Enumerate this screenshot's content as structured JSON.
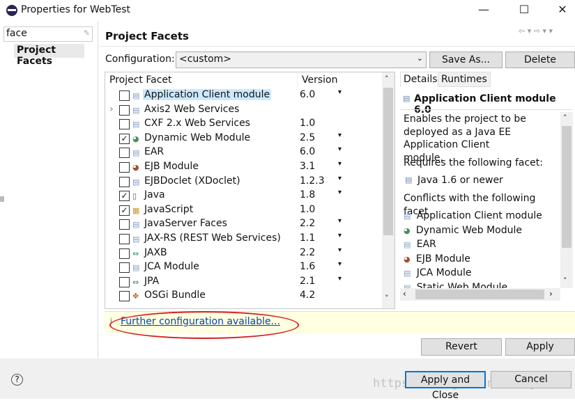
{
  "window": {
    "title": "Properties for WebTest",
    "minimize": "—",
    "maximize": "☐",
    "close": "✕"
  },
  "sidebar": {
    "filter_value": "face",
    "items": [
      {
        "label": "Project Facets",
        "selected": true
      }
    ]
  },
  "page": {
    "title": "Project Facets",
    "nav": "⇦ ▾ ⇨ ▾ ▾"
  },
  "configuration": {
    "label": "Configuration:",
    "value": "<custom>",
    "save_as": "Save As...",
    "delete": "Delete"
  },
  "facets": {
    "columns": [
      "Project Facet",
      "Version"
    ],
    "rows": [
      {
        "name": "Application Client module",
        "version": "6.0",
        "checked": false,
        "dropdown": true,
        "icon": "file-icon",
        "selected": true
      },
      {
        "name": "Axis2 Web Services",
        "version": "",
        "checked": false,
        "dropdown": false,
        "icon": "file-icon",
        "expandable": true
      },
      {
        "name": "CXF 2.x Web Services",
        "version": "1.0",
        "checked": false,
        "dropdown": false,
        "icon": "file-icon"
      },
      {
        "name": "Dynamic Web Module",
        "version": "2.5",
        "checked": true,
        "dropdown": true,
        "icon": "globe-icon"
      },
      {
        "name": "EAR",
        "version": "6.0",
        "checked": false,
        "dropdown": true,
        "icon": "file-icon"
      },
      {
        "name": "EJB Module",
        "version": "3.1",
        "checked": false,
        "dropdown": true,
        "icon": "bean-icon"
      },
      {
        "name": "EJBDoclet (XDoclet)",
        "version": "1.2.3",
        "checked": false,
        "dropdown": true,
        "icon": "file-icon"
      },
      {
        "name": "Java",
        "version": "1.8",
        "checked": true,
        "dropdown": true,
        "icon": "java-icon"
      },
      {
        "name": "JavaScript",
        "version": "1.0",
        "checked": true,
        "dropdown": false,
        "icon": "js-icon"
      },
      {
        "name": "JavaServer Faces",
        "version": "2.2",
        "checked": false,
        "dropdown": true,
        "icon": "file-icon"
      },
      {
        "name": "JAX-RS (REST Web Services)",
        "version": "1.1",
        "checked": false,
        "dropdown": true,
        "icon": "file-icon"
      },
      {
        "name": "JAXB",
        "version": "2.2",
        "checked": false,
        "dropdown": true,
        "icon": "arrows-icon"
      },
      {
        "name": "JCA Module",
        "version": "1.6",
        "checked": false,
        "dropdown": true,
        "icon": "file-icon"
      },
      {
        "name": "JPA",
        "version": "2.1",
        "checked": false,
        "dropdown": true,
        "icon": "arrows-icon"
      },
      {
        "name": "OSGi Bundle",
        "version": "4.2",
        "checked": false,
        "dropdown": false,
        "icon": "plugin-icon"
      }
    ]
  },
  "details": {
    "tabs": [
      "Details",
      "Runtimes"
    ],
    "heading": "Application Client module 6.0",
    "description": "Enables the project to be deployed as a Java EE Application Client module.",
    "requires_label": "Requires the following facet:",
    "requires": [
      "Java 1.6 or newer"
    ],
    "conflicts_label": "Conflicts with the following facet",
    "conflicts": [
      "Application Client module",
      "Dynamic Web Module",
      "EAR",
      "EJB Module",
      "JCA Module",
      "Static Web Module"
    ]
  },
  "info_bar": {
    "link": "Further configuration available..."
  },
  "buttons": {
    "revert": "Revert",
    "apply": "Apply",
    "apply_close": "Apply and Close",
    "cancel": "Cancel",
    "help": "?"
  },
  "watermark": "https://blog.csdn.net/yzfst",
  "colors": {
    "link": "#0645ad",
    "annotation": "#d42020",
    "selection": "#cce8ff",
    "info_bg": "#ffffe1"
  }
}
